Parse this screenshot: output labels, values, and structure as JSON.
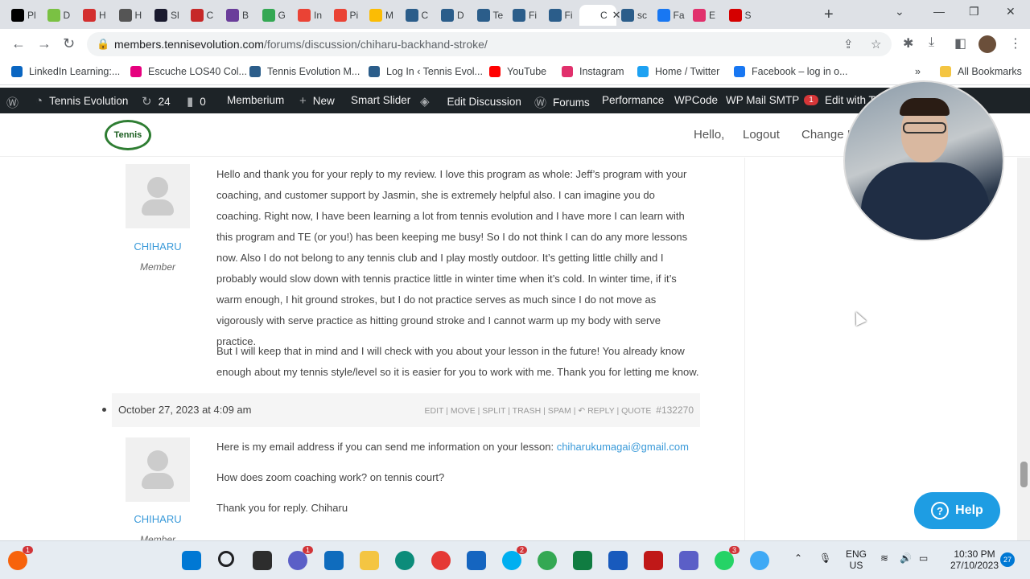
{
  "browser": {
    "tabs": [
      {
        "label": "Pl",
        "color": "#000000",
        "icon": "x-icon"
      },
      {
        "label": "D",
        "color": "#7ac143",
        "icon": "duolingo-icon"
      },
      {
        "label": "H",
        "color": "#d32f2f",
        "icon": "h-icon"
      },
      {
        "label": "H",
        "color": "#555555",
        "icon": "globe-icon"
      },
      {
        "label": "Sl",
        "color": "#1a1a2e",
        "icon": "slider-icon"
      },
      {
        "label": "C",
        "color": "#c62828",
        "icon": "c-icon"
      },
      {
        "label": "B",
        "color": "#6a3d9a",
        "icon": "b-icon"
      },
      {
        "label": "G",
        "color": "#34a853",
        "icon": "maps-icon"
      },
      {
        "label": "In",
        "color": "#ea4335",
        "icon": "gmail-icon"
      },
      {
        "label": "Pi",
        "color": "#ea4335",
        "icon": "gmail-icon"
      },
      {
        "label": "M",
        "color": "#fbbc04",
        "icon": "drive-icon"
      },
      {
        "label": "C",
        "color": "#2b5d8a",
        "icon": "tennis-icon"
      },
      {
        "label": "D",
        "color": "#2b5d8a",
        "icon": "tennis-icon"
      },
      {
        "label": "Te",
        "color": "#2b5d8a",
        "icon": "tennis-icon"
      },
      {
        "label": "Fi",
        "color": "#2b5d8a",
        "icon": "tennis-icon"
      },
      {
        "label": "Fi",
        "color": "#2b5d8a",
        "icon": "tennis-icon"
      },
      {
        "label": "C",
        "color": "#ffffff",
        "icon": "blank-icon",
        "active": true
      },
      {
        "label": "sc",
        "color": "#2b5d8a",
        "icon": "tennis-icon"
      },
      {
        "label": "Fa",
        "color": "#1877f2",
        "icon": "facebook-icon"
      },
      {
        "label": "E",
        "color": "#e1306c",
        "icon": "instagram-icon"
      },
      {
        "label": "S",
        "color": "#d50000",
        "icon": "s-icon"
      }
    ],
    "url_host": "members.tennisevolution.com",
    "url_path": "/forums/discussion/chiharu-backhand-stroke/",
    "bookmarks": [
      {
        "label": "LinkedIn Learning:...",
        "color": "#0a66c2"
      },
      {
        "label": "Escuche LOS40 Col...",
        "color": "#e6007e"
      },
      {
        "label": "Tennis Evolution M...",
        "color": "#2b5d8a"
      },
      {
        "label": "Log In ‹ Tennis Evol...",
        "color": "#2b5d8a"
      },
      {
        "label": "YouTube",
        "color": "#ff0000"
      },
      {
        "label": "Instagram",
        "color": "#e1306c"
      },
      {
        "label": "Home / Twitter",
        "color": "#1da1f2"
      },
      {
        "label": "Facebook – log in o...",
        "color": "#1877f2"
      }
    ],
    "bookmarks_more": "»",
    "all_bookmarks": "All Bookmarks"
  },
  "adminbar": {
    "site": "Tennis Evolution",
    "updates": "24",
    "comments": "0",
    "items": [
      "Memberium",
      "New",
      "Smart Slider",
      "Edit Discussion",
      "Forums",
      "Performance",
      "WPCode",
      "WP Mail SMTP",
      "Edit with T"
    ],
    "smtp_badge": "1"
  },
  "site_header": {
    "logo_text": "Tennis",
    "hello": "Hello,",
    "logout": "Logout",
    "change": "Change P"
  },
  "reply1": {
    "author": "CHIHARU",
    "role": "Member",
    "para1": "Hello and thank you for your reply to my review. I love this program as whole: Jeff’s program with your coaching, and customer support by Jasmin, she is extremely helpful also. I can imagine you do coaching. Right now, I have been learning a lot from tennis evolution and I have more I can learn with this program and TE (or you!) has been keeping me busy! So I do not think I can do any more lessons now. Also I do not belong to any tennis club and I play mostly outdoor. It’s getting little chilly and I probably would slow down with tennis practice little in winter time when it’s cold. In winter time, if it’s warm enough, I hit ground strokes, but I do not practice serves as much since I do not move as vigorously with serve practice as hitting ground stroke and I cannot warm up my body with serve practice.",
    "para2": "But I will keep that in mind and I will check with you about your lesson in the future! You already know enough about my tennis style/level so it is easier for you to work with me. Thank you for letting me know."
  },
  "reply2": {
    "date": "October 27, 2023 at 4:09 am",
    "actions": "EDIT | MOVE | SPLIT | TRASH | SPAM | ↶ REPLY | QUOTE",
    "post_id": "#132270",
    "author": "CHIHARU",
    "role": "Member",
    "line1": "Here is my email address if you can send me information on your lesson: ",
    "email": "chiharukumagai@gmail.com",
    "line2": "How does zoom coaching work? on tennis court?",
    "line3": "Thank you for reply. Chiharu"
  },
  "help_button": "Help",
  "taskbar": {
    "lang_top": "ENG",
    "lang_bottom": "US",
    "time": "10:30 PM",
    "date": "27/10/2023",
    "notif_count": "27",
    "badges": {
      "teams": "1",
      "skype": "2",
      "whatsapp": "3",
      "start": "1"
    }
  }
}
